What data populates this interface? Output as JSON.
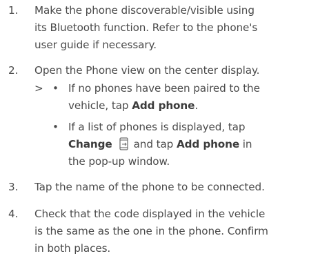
{
  "steps": [
    {
      "number": "1.",
      "lines": [
        "Make the phone discoverable/visible using",
        "its Bluetooth function. Refer to the phone's",
        "user guide if necessary."
      ]
    },
    {
      "number": "2.",
      "lines": [
        "Open the Phone view on the center display."
      ],
      "arrow": ">",
      "bullets": [
        {
          "line1_pre": "If no phones have been paired to the",
          "line2_pre": "vehicle, tap ",
          "line2_bold": "Add phone",
          "line2_post": "."
        },
        {
          "line1": "If a list of phones is displayed, tap",
          "change_bold": "Change",
          "change_icon": "phone-switch-icon",
          "and_tap": "and tap ",
          "add_bold": "Add phone",
          "in_text": " in",
          "line3": "the pop-up window."
        }
      ]
    },
    {
      "number": "3.",
      "lines": [
        "Tap the name of the phone to be connected."
      ]
    },
    {
      "number": "4.",
      "lines": [
        "Check that the code displayed in the vehicle",
        "is the same as the one in the phone. Confirm",
        "in both places."
      ]
    }
  ],
  "bullet_char": "•"
}
